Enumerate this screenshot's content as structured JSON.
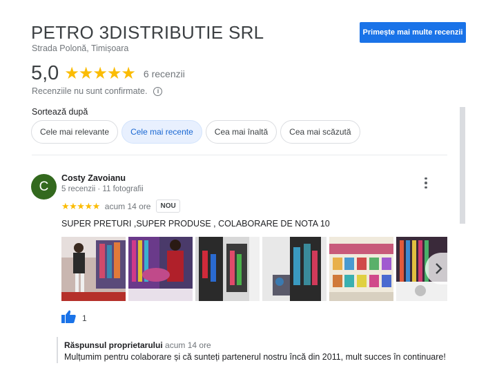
{
  "business": {
    "name": "PETRO 3DISTRIBUTIE SRL",
    "address": "Strada Polonă, Timișoara",
    "get_more_reviews_label": "Primește mai multe recenzii",
    "rating": "5,0",
    "stars": 5,
    "review_count_label": "6 recenzii",
    "unconfirmed_note": "Recenzii​le nu sunt confirmate."
  },
  "sort": {
    "label": "Sortează după",
    "options": [
      {
        "label": "Cele mai relevante",
        "active": false
      },
      {
        "label": "Cele mai recente",
        "active": true
      },
      {
        "label": "Cea mai înaltă",
        "active": false
      },
      {
        "label": "Cea mai scăzută",
        "active": false
      }
    ]
  },
  "review": {
    "avatar_letter": "C",
    "avatar_color": "#33691e",
    "author": "Costy Zavoianu",
    "meta": "5 recenzii · 11 fotografii",
    "stars": 5,
    "time": "acum 14 ore",
    "badge": "NOU",
    "text": "SUPER PRETURI ,SUPER PRODUSE , COLABORARE DE NOTA 10",
    "photo_count_visible": 6,
    "likes": "1"
  },
  "owner_reply": {
    "label": "Răspunsul proprietarului",
    "time": "acum 14 ore",
    "text": "Mulțumim pentru colaborare și că sunteți partenerul nostru încă din 2011, mult succes în continuare!"
  },
  "colors": {
    "accent": "#1a73e8",
    "star": "#fbbc04",
    "chip_active_bg": "#e8f0fe",
    "chip_active_text": "#1967d2"
  }
}
